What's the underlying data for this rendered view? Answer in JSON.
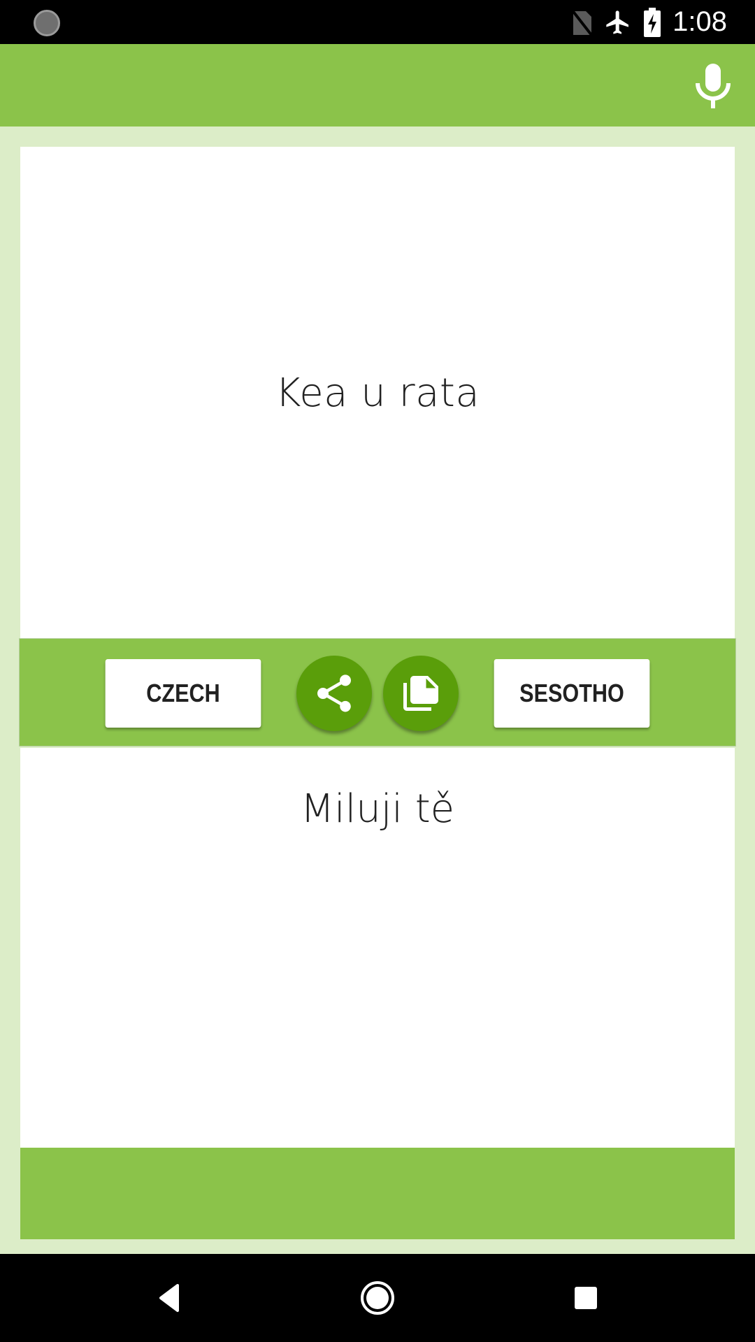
{
  "status_bar": {
    "time": "1:08",
    "icons": [
      "loading-spinner-icon",
      "no-sim-icon",
      "airplane-mode-icon",
      "battery-charging-icon"
    ]
  },
  "app_bar": {
    "mic_icon": "microphone-icon"
  },
  "translation": {
    "source_text": "Kea u rata",
    "target_text": "Miluji tě"
  },
  "toolbar": {
    "left_language": "CZECH",
    "right_language": "SESOTHO",
    "share_icon": "share-icon",
    "copy_icon": "copy-icon"
  },
  "nav_bar": {
    "back_icon": "back-icon",
    "home_icon": "home-icon",
    "recents_icon": "recents-icon"
  },
  "colors": {
    "primary": "#8bc34a",
    "primary_dark": "#5a9e0a",
    "background": "#dcedc8",
    "text": "#212121"
  }
}
